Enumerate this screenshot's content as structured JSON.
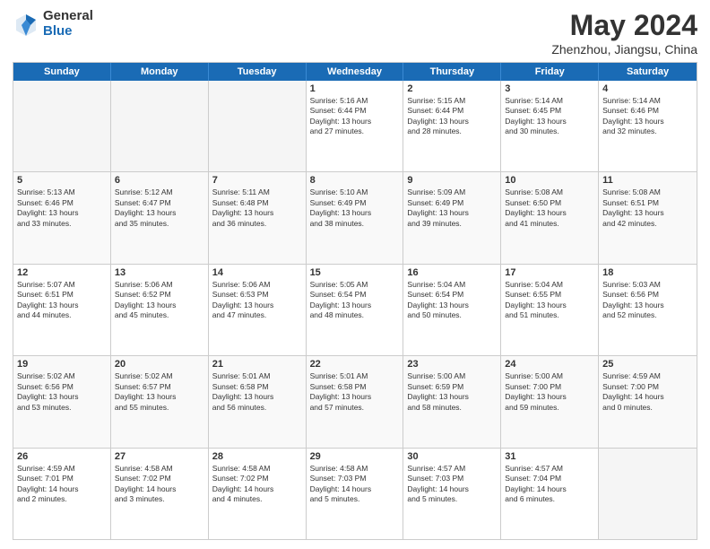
{
  "logo": {
    "general": "General",
    "blue": "Blue"
  },
  "title": "May 2024",
  "subtitle": "Zhenzhou, Jiangsu, China",
  "header_days": [
    "Sunday",
    "Monday",
    "Tuesday",
    "Wednesday",
    "Thursday",
    "Friday",
    "Saturday"
  ],
  "rows": [
    [
      {
        "day": "",
        "text": ""
      },
      {
        "day": "",
        "text": ""
      },
      {
        "day": "",
        "text": ""
      },
      {
        "day": "1",
        "text": "Sunrise: 5:16 AM\nSunset: 6:44 PM\nDaylight: 13 hours\nand 27 minutes."
      },
      {
        "day": "2",
        "text": "Sunrise: 5:15 AM\nSunset: 6:44 PM\nDaylight: 13 hours\nand 28 minutes."
      },
      {
        "day": "3",
        "text": "Sunrise: 5:14 AM\nSunset: 6:45 PM\nDaylight: 13 hours\nand 30 minutes."
      },
      {
        "day": "4",
        "text": "Sunrise: 5:14 AM\nSunset: 6:46 PM\nDaylight: 13 hours\nand 32 minutes."
      }
    ],
    [
      {
        "day": "5",
        "text": "Sunrise: 5:13 AM\nSunset: 6:46 PM\nDaylight: 13 hours\nand 33 minutes."
      },
      {
        "day": "6",
        "text": "Sunrise: 5:12 AM\nSunset: 6:47 PM\nDaylight: 13 hours\nand 35 minutes."
      },
      {
        "day": "7",
        "text": "Sunrise: 5:11 AM\nSunset: 6:48 PM\nDaylight: 13 hours\nand 36 minutes."
      },
      {
        "day": "8",
        "text": "Sunrise: 5:10 AM\nSunset: 6:49 PM\nDaylight: 13 hours\nand 38 minutes."
      },
      {
        "day": "9",
        "text": "Sunrise: 5:09 AM\nSunset: 6:49 PM\nDaylight: 13 hours\nand 39 minutes."
      },
      {
        "day": "10",
        "text": "Sunrise: 5:08 AM\nSunset: 6:50 PM\nDaylight: 13 hours\nand 41 minutes."
      },
      {
        "day": "11",
        "text": "Sunrise: 5:08 AM\nSunset: 6:51 PM\nDaylight: 13 hours\nand 42 minutes."
      }
    ],
    [
      {
        "day": "12",
        "text": "Sunrise: 5:07 AM\nSunset: 6:51 PM\nDaylight: 13 hours\nand 44 minutes."
      },
      {
        "day": "13",
        "text": "Sunrise: 5:06 AM\nSunset: 6:52 PM\nDaylight: 13 hours\nand 45 minutes."
      },
      {
        "day": "14",
        "text": "Sunrise: 5:06 AM\nSunset: 6:53 PM\nDaylight: 13 hours\nand 47 minutes."
      },
      {
        "day": "15",
        "text": "Sunrise: 5:05 AM\nSunset: 6:54 PM\nDaylight: 13 hours\nand 48 minutes."
      },
      {
        "day": "16",
        "text": "Sunrise: 5:04 AM\nSunset: 6:54 PM\nDaylight: 13 hours\nand 50 minutes."
      },
      {
        "day": "17",
        "text": "Sunrise: 5:04 AM\nSunset: 6:55 PM\nDaylight: 13 hours\nand 51 minutes."
      },
      {
        "day": "18",
        "text": "Sunrise: 5:03 AM\nSunset: 6:56 PM\nDaylight: 13 hours\nand 52 minutes."
      }
    ],
    [
      {
        "day": "19",
        "text": "Sunrise: 5:02 AM\nSunset: 6:56 PM\nDaylight: 13 hours\nand 53 minutes."
      },
      {
        "day": "20",
        "text": "Sunrise: 5:02 AM\nSunset: 6:57 PM\nDaylight: 13 hours\nand 55 minutes."
      },
      {
        "day": "21",
        "text": "Sunrise: 5:01 AM\nSunset: 6:58 PM\nDaylight: 13 hours\nand 56 minutes."
      },
      {
        "day": "22",
        "text": "Sunrise: 5:01 AM\nSunset: 6:58 PM\nDaylight: 13 hours\nand 57 minutes."
      },
      {
        "day": "23",
        "text": "Sunrise: 5:00 AM\nSunset: 6:59 PM\nDaylight: 13 hours\nand 58 minutes."
      },
      {
        "day": "24",
        "text": "Sunrise: 5:00 AM\nSunset: 7:00 PM\nDaylight: 13 hours\nand 59 minutes."
      },
      {
        "day": "25",
        "text": "Sunrise: 4:59 AM\nSunset: 7:00 PM\nDaylight: 14 hours\nand 0 minutes."
      }
    ],
    [
      {
        "day": "26",
        "text": "Sunrise: 4:59 AM\nSunset: 7:01 PM\nDaylight: 14 hours\nand 2 minutes."
      },
      {
        "day": "27",
        "text": "Sunrise: 4:58 AM\nSunset: 7:02 PM\nDaylight: 14 hours\nand 3 minutes."
      },
      {
        "day": "28",
        "text": "Sunrise: 4:58 AM\nSunset: 7:02 PM\nDaylight: 14 hours\nand 4 minutes."
      },
      {
        "day": "29",
        "text": "Sunrise: 4:58 AM\nSunset: 7:03 PM\nDaylight: 14 hours\nand 5 minutes."
      },
      {
        "day": "30",
        "text": "Sunrise: 4:57 AM\nSunset: 7:03 PM\nDaylight: 14 hours\nand 5 minutes."
      },
      {
        "day": "31",
        "text": "Sunrise: 4:57 AM\nSunset: 7:04 PM\nDaylight: 14 hours\nand 6 minutes."
      },
      {
        "day": "",
        "text": ""
      }
    ]
  ]
}
